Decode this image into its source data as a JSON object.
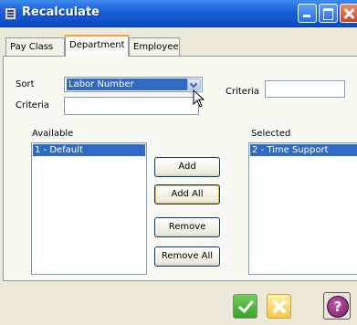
{
  "window": {
    "title": "Recalculate"
  },
  "tabs": [
    {
      "label": "Pay Class"
    },
    {
      "label": "Department"
    },
    {
      "label": "Employee"
    }
  ],
  "active_tab": "Department",
  "filter": {
    "sort_label": "Sort",
    "sort_value": "Labor Number",
    "criteria_label_left": "Criteria",
    "criteria_value_left": "",
    "criteria_label_right": "Criteria",
    "criteria_value_right": ""
  },
  "available": {
    "header": "Available",
    "items": [
      "1 - Default"
    ]
  },
  "selected": {
    "header": "Selected",
    "items": [
      "2 - Time Support"
    ]
  },
  "actions": {
    "add_label": "Add",
    "add_all_label": "Add All",
    "remove_label": "Remove",
    "remove_all_label": "Remove All"
  },
  "footer": {
    "help_glyph": "?"
  },
  "icons": [
    "window-icon",
    "minimize-icon",
    "maximize-icon",
    "close-icon",
    "chevron-down-icon",
    "checkmark-icon",
    "x-icon",
    "help-icon",
    "mouse-cursor-icon"
  ],
  "colors": {
    "titlebar": "#0b49c4",
    "selection": "#316ac5",
    "ok": "#3aa22a",
    "cancel": "#f5c84a",
    "help": "#7a1a6a"
  }
}
